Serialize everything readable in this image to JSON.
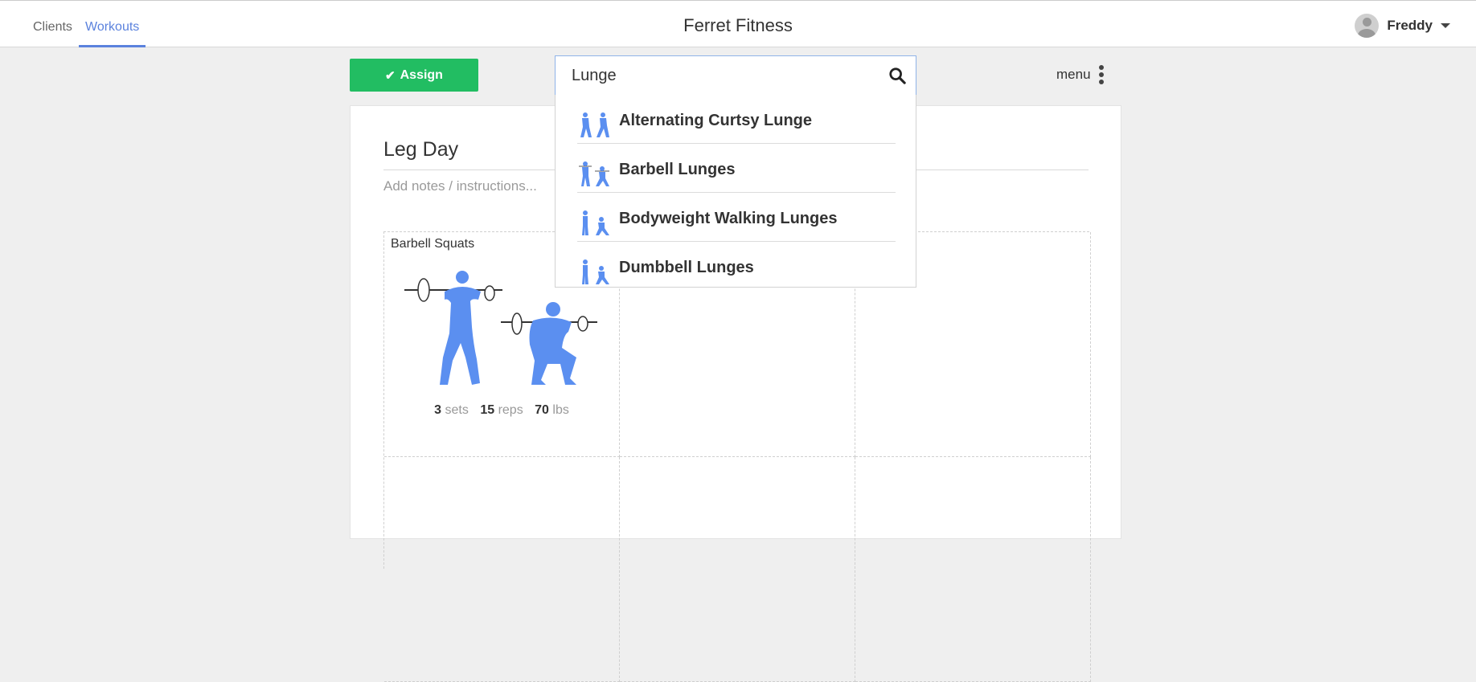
{
  "nav": {
    "tabs": [
      {
        "label": "Clients",
        "active": false
      },
      {
        "label": "Workouts",
        "active": true
      }
    ],
    "brand": "Ferret Fitness",
    "user_name": "Freddy"
  },
  "toolbar": {
    "assign_label": "Assign",
    "search_value": "Lunge",
    "menu_label": "menu"
  },
  "workout": {
    "title": "Leg Day",
    "notes_placeholder": "Add notes / instructions...",
    "exercises": [
      {
        "name": "Barbell Squats",
        "sets": "3",
        "sets_unit": "sets",
        "reps": "15",
        "reps_unit": "reps",
        "weight": "70",
        "weight_unit": "lbs"
      }
    ]
  },
  "search_results": [
    "Alternating Curtsy Lunge",
    "Barbell Lunges",
    "Bodyweight Walking Lunges",
    "Dumbbell Lunges"
  ],
  "colors": {
    "accent": "#5b82dd",
    "assign_green": "#22bd62",
    "figure_blue": "#5b8ff0"
  },
  "icons": {
    "search": "magnifier-icon",
    "assign": "check-icon",
    "menu": "kebab-icon",
    "dropdown": "caret-down-icon"
  }
}
